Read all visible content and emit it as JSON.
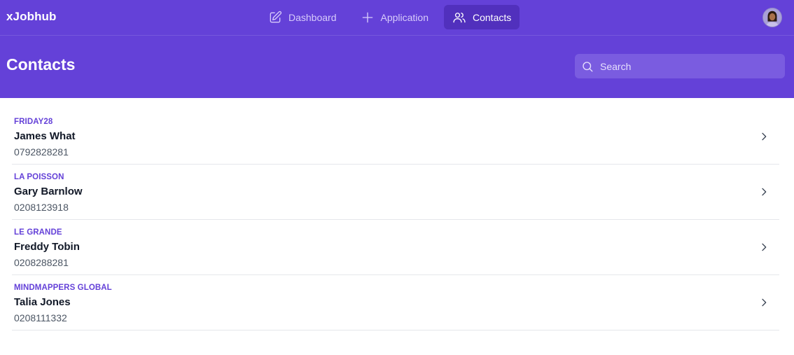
{
  "app": {
    "title": "xJobhub"
  },
  "nav": {
    "items": [
      {
        "label": "Dashboard",
        "icon": "pencil-square-icon",
        "active": false
      },
      {
        "label": "Application",
        "icon": "plus-icon",
        "active": false
      },
      {
        "label": "Contacts",
        "icon": "users-icon",
        "active": true
      }
    ]
  },
  "page": {
    "title": "Contacts"
  },
  "search": {
    "placeholder": "Search"
  },
  "contacts": [
    {
      "company": "FRIDAY28",
      "name": "James What",
      "phone": "0792828281"
    },
    {
      "company": "LA POISSON",
      "name": "Gary Barnlow",
      "phone": "0208123918"
    },
    {
      "company": "LE GRANDE",
      "name": "Freddy Tobin",
      "phone": "0208288281"
    },
    {
      "company": "MINDMAPPERS GLOBAL",
      "name": "Talia Jones",
      "phone": "0208111332"
    }
  ],
  "colors": {
    "brand": "#6441d8",
    "active_nav": "#5130bd",
    "company_text": "#6441d8"
  }
}
